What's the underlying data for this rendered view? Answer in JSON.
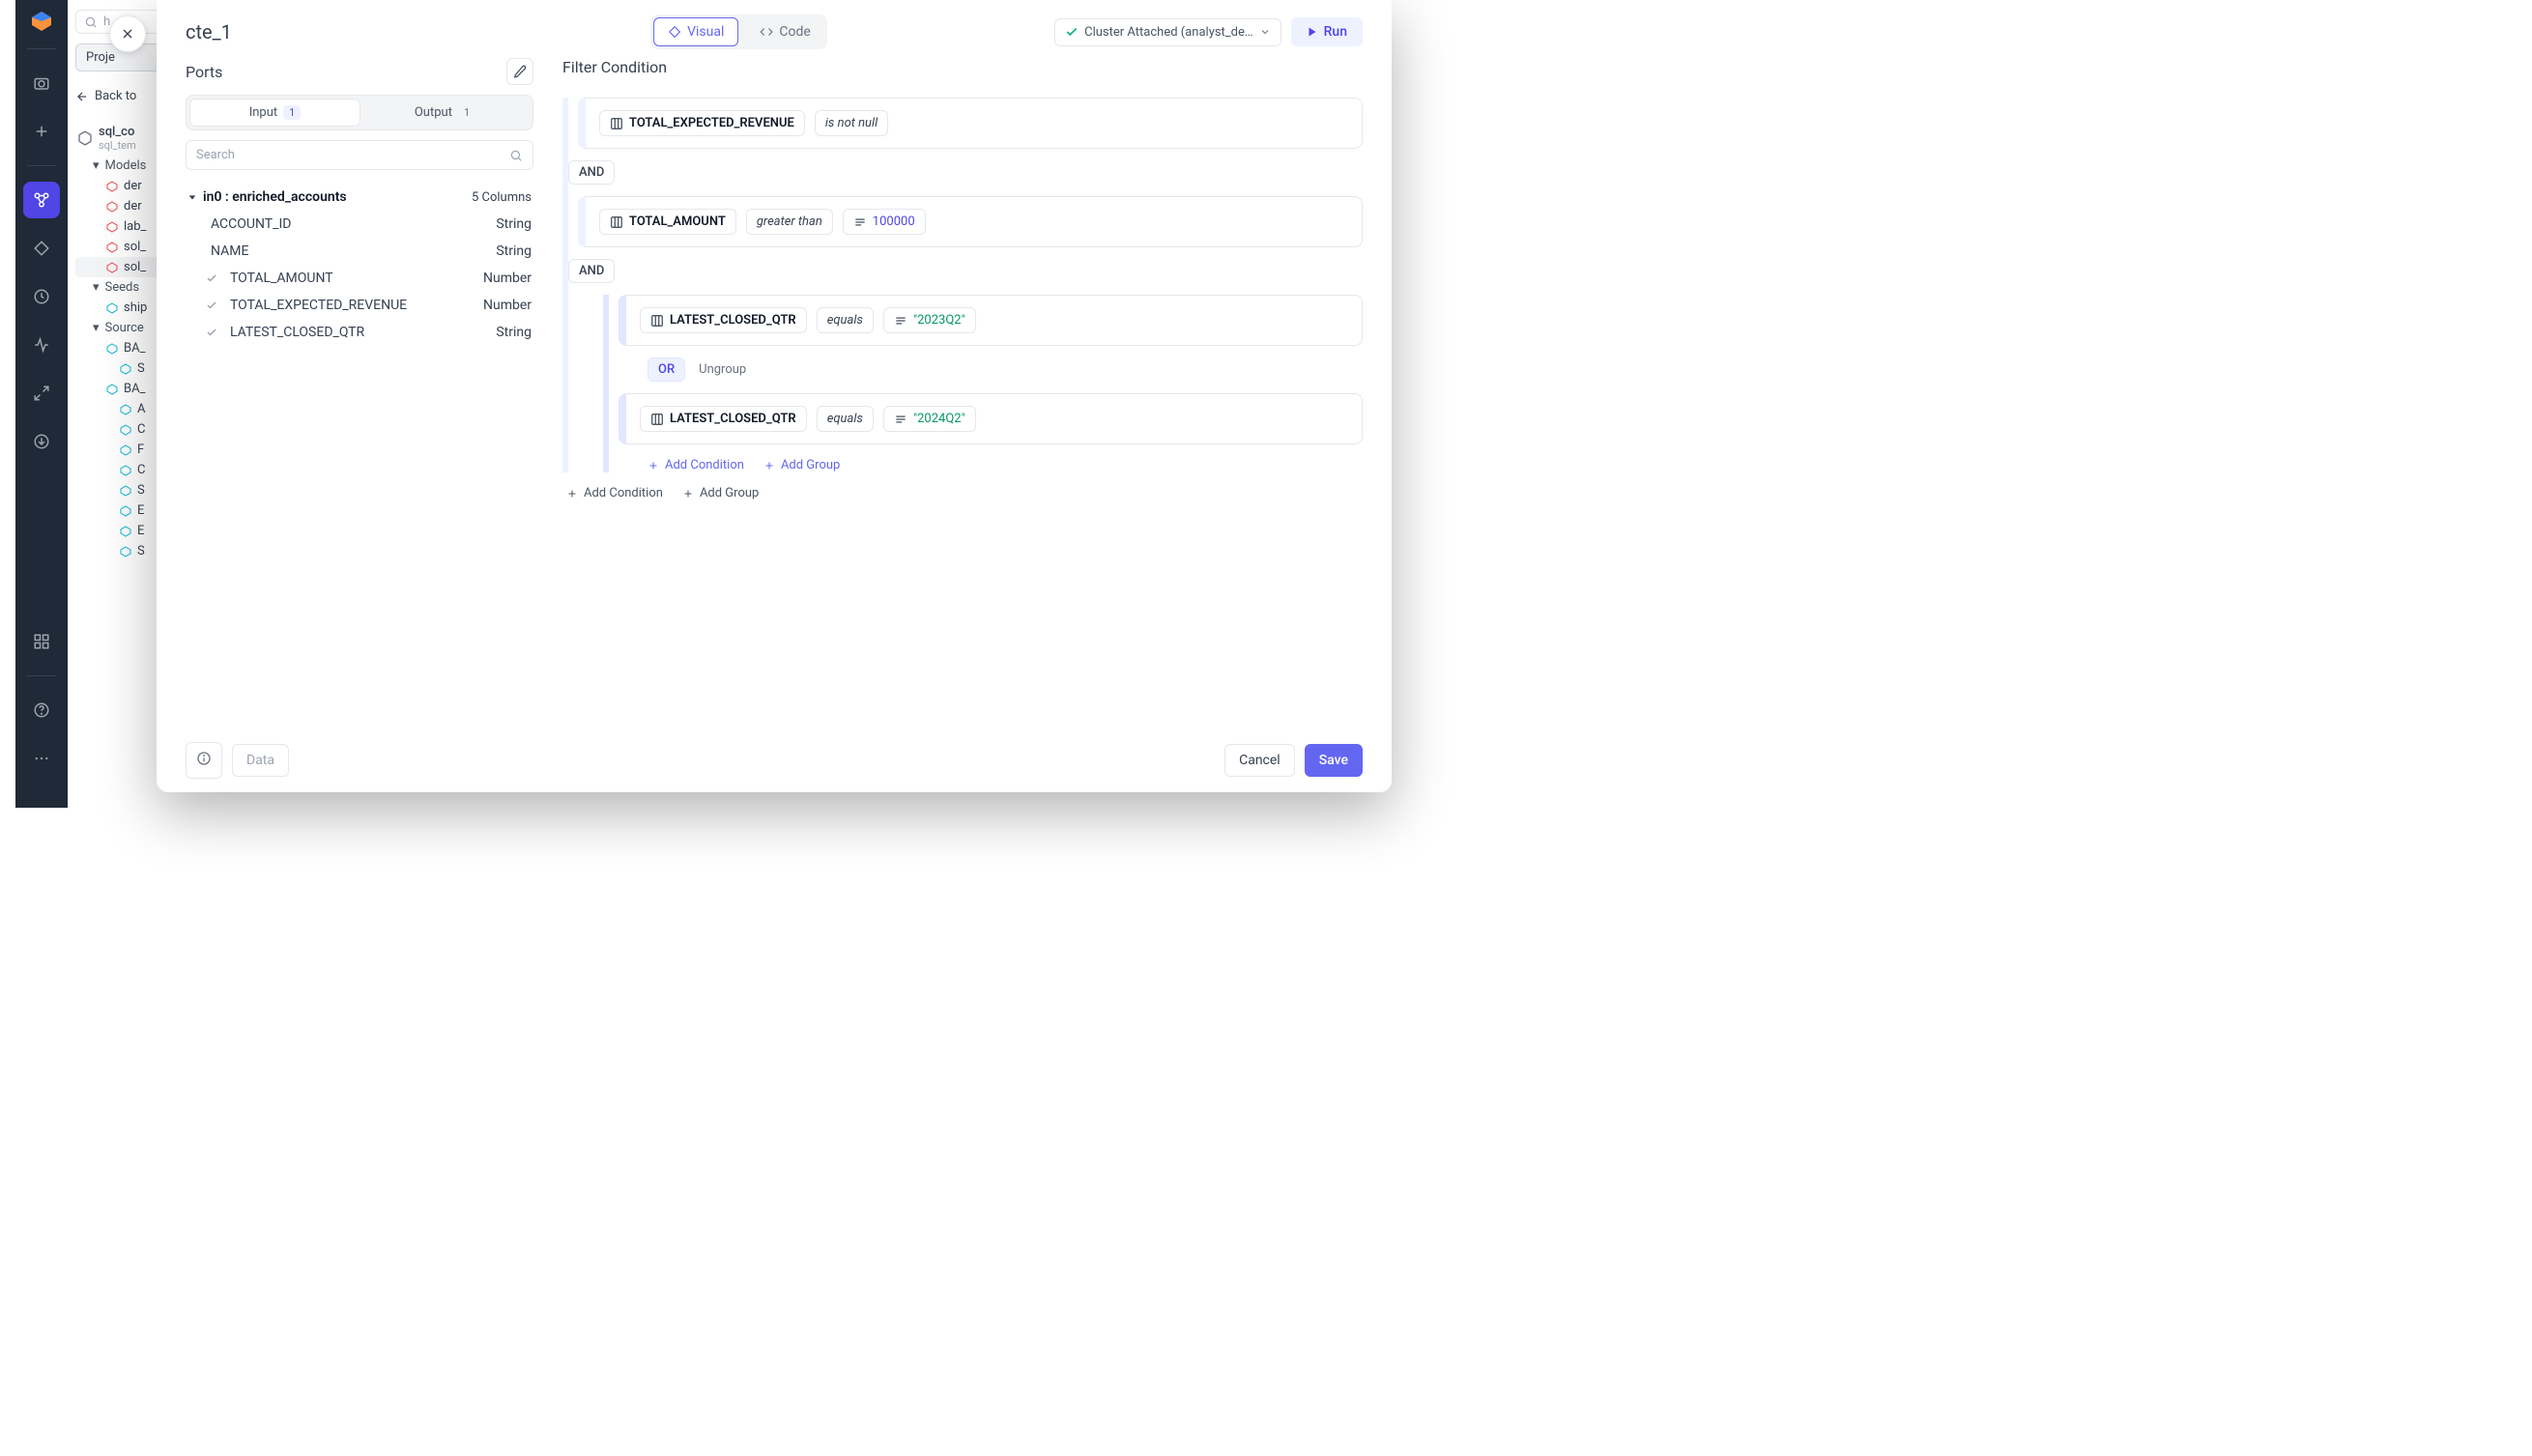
{
  "iconbar": {
    "logo": "logo"
  },
  "explorer": {
    "search_placeholder": "h",
    "proj_button": "Proje",
    "back_label": "Back to",
    "item1_name": "sql_co",
    "item1_sub": "sql_tem",
    "models_label": "Models",
    "seeds_label": "Seeds",
    "sources_label": "Source",
    "model_items": [
      "der",
      "der",
      "lab_",
      "sol_",
      "sol_"
    ],
    "seed_items": [
      "ship"
    ],
    "source_items": [
      "BA_",
      "S",
      "BA_",
      "A",
      "C",
      "F",
      "C",
      "S",
      "E",
      "E",
      "S"
    ]
  },
  "modal": {
    "title": "cte_1",
    "tabs": {
      "visual": "Visual",
      "code": "Code"
    },
    "cluster_label": "Cluster Attached (analyst_de…",
    "run_label": "Run",
    "ports": {
      "title": "Ports",
      "input_label": "Input",
      "input_count": "1",
      "output_label": "Output",
      "output_count": "1",
      "search_placeholder": "Search",
      "port_name": "in0 : enriched_accounts",
      "column_count": "5 Columns",
      "columns": [
        {
          "name": "ACCOUNT_ID",
          "type": "String",
          "used": false
        },
        {
          "name": "NAME",
          "type": "String",
          "used": false
        },
        {
          "name": "TOTAL_AMOUNT",
          "type": "Number",
          "used": true
        },
        {
          "name": "TOTAL_EXPECTED_REVENUE",
          "type": "Number",
          "used": true
        },
        {
          "name": "LATEST_CLOSED_QTR",
          "type": "String",
          "used": true
        }
      ]
    },
    "filter": {
      "title": "Filter Condition",
      "conditions": [
        {
          "col": "TOTAL_EXPECTED_REVENUE",
          "op": "is not null"
        },
        {
          "logic": "AND"
        },
        {
          "col": "TOTAL_AMOUNT",
          "op": "greater than",
          "val": "100000",
          "val_type": "num"
        },
        {
          "logic": "AND"
        }
      ],
      "nested": {
        "conditions": [
          {
            "col": "LATEST_CLOSED_QTR",
            "op": "equals",
            "val": "\"2023Q2\"",
            "val_type": "str"
          },
          {
            "logic": "OR",
            "ungroup": "Ungroup"
          },
          {
            "col": "LATEST_CLOSED_QTR",
            "op": "equals",
            "val": "\"2024Q2\"",
            "val_type": "str"
          }
        ],
        "add_condition": "Add Condition",
        "add_group": "Add Group"
      },
      "add_condition": "Add Condition",
      "add_group": "Add Group"
    },
    "footer": {
      "data": "Data",
      "cancel": "Cancel",
      "save": "Save"
    }
  }
}
